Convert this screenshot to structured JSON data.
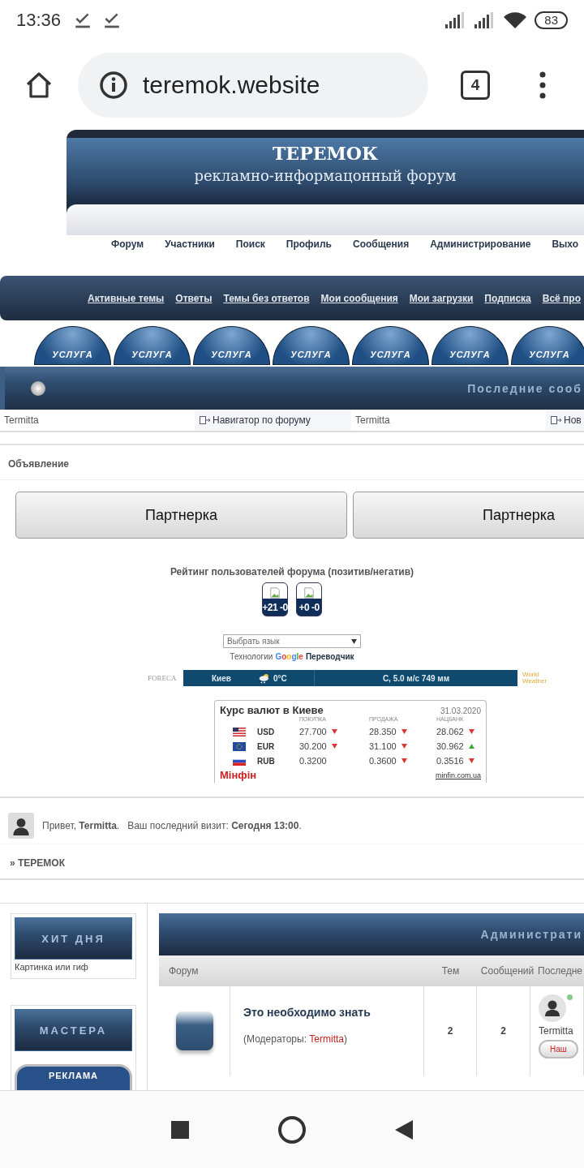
{
  "status_bar": {
    "time": "13:36",
    "battery": "83"
  },
  "browser": {
    "url": "teremok.website",
    "tab_count": "4"
  },
  "banner": {
    "title": "ТЕРЕМОК",
    "subtitle": "рекламно-информацонный форум"
  },
  "main_nav": [
    "Форум",
    "Участники",
    "Поиск",
    "Профиль",
    "Сообщения",
    "Администрирование",
    "Выхо"
  ],
  "quick_links": [
    "Активные темы",
    "Ответы",
    "Темы без ответов",
    "Мои сообщения",
    "Мои загрузки",
    "Подписка",
    "Всё про"
  ],
  "service_tabs": [
    "УСЛУГА",
    "УСЛУГА",
    "УСЛУГА",
    "УСЛУГА",
    "УСЛУГА",
    "УСЛУГА",
    "УСЛУГА"
  ],
  "latest_bar": {
    "title": "Последние сооб"
  },
  "latest_row": [
    {
      "kind": "user",
      "text": "Termitta"
    },
    {
      "kind": "topic",
      "text": "Навигатор по форуму"
    },
    {
      "kind": "user",
      "text": "Termitta"
    },
    {
      "kind": "topic",
      "text": "Нов"
    }
  ],
  "announcement": {
    "heading": "Объявление",
    "buttons": [
      "Партнерка",
      "Партнерка"
    ]
  },
  "rating": {
    "title": "Рейтинг пользователей форума (позитив/негатив)",
    "badges": [
      "+21 -0",
      "+0 -0"
    ]
  },
  "translator": {
    "placeholder": "Выбрать язык",
    "caption": "Технологии",
    "brand": "Google",
    "service": "Переводчик"
  },
  "weather": {
    "left_logo": "FORECA",
    "city": "Киев",
    "temperature": "0°C",
    "details": "С, 5.0 м/с 749 мм",
    "right_logo": "World Weather"
  },
  "currency": {
    "title": "Курс валют в Киеве",
    "date": "31.03.2020",
    "columns": [
      "ПОКУПКА",
      "ПРОДАЖА",
      "НАЦБАНК"
    ],
    "rows": [
      {
        "code": "USD",
        "values": [
          {
            "text": "27.700",
            "falling": true
          },
          {
            "text": "28.350",
            "falling": true
          },
          {
            "text": "28.062",
            "falling": true
          }
        ]
      },
      {
        "code": "EUR",
        "values": [
          {
            "text": "30.200",
            "falling": true
          },
          {
            "text": "31.100",
            "falling": true
          },
          {
            "text": "30.962",
            "falling": false
          }
        ]
      },
      {
        "code": "RUB",
        "values": [
          {
            "text": "0.3200"
          },
          {
            "text": "0.3600",
            "falling": true
          },
          {
            "text": "0.3516",
            "falling": true
          }
        ]
      }
    ],
    "brand": "Мінфін",
    "link": "minfin.com.ua"
  },
  "greeting": "Привет, **Termitta**.   Ваш последний визит: **Сегодня 13:00**.",
  "breadcrumb": "» ТЕРЕМОК",
  "sidebar": [
    {
      "title": "ХИТ ДНЯ",
      "caption": "Картинка или гиф"
    },
    {
      "title": "МАСТЕРА",
      "button": "РЕКЛАМА"
    }
  ],
  "forum_table": {
    "title": "Администрати",
    "columns": [
      "Форум",
      "Тем",
      "Сообщений",
      "Последне"
    ],
    "rows": [
      {
        "name": "Это необходимо знать",
        "moderators_label": "(Модераторы: ",
        "moderator": "Termitta",
        "moderators_end": ")",
        "topics": "2",
        "posts": "2",
        "last_user": "Termitta",
        "last_button": "Наш",
        "online": true
      }
    ]
  }
}
